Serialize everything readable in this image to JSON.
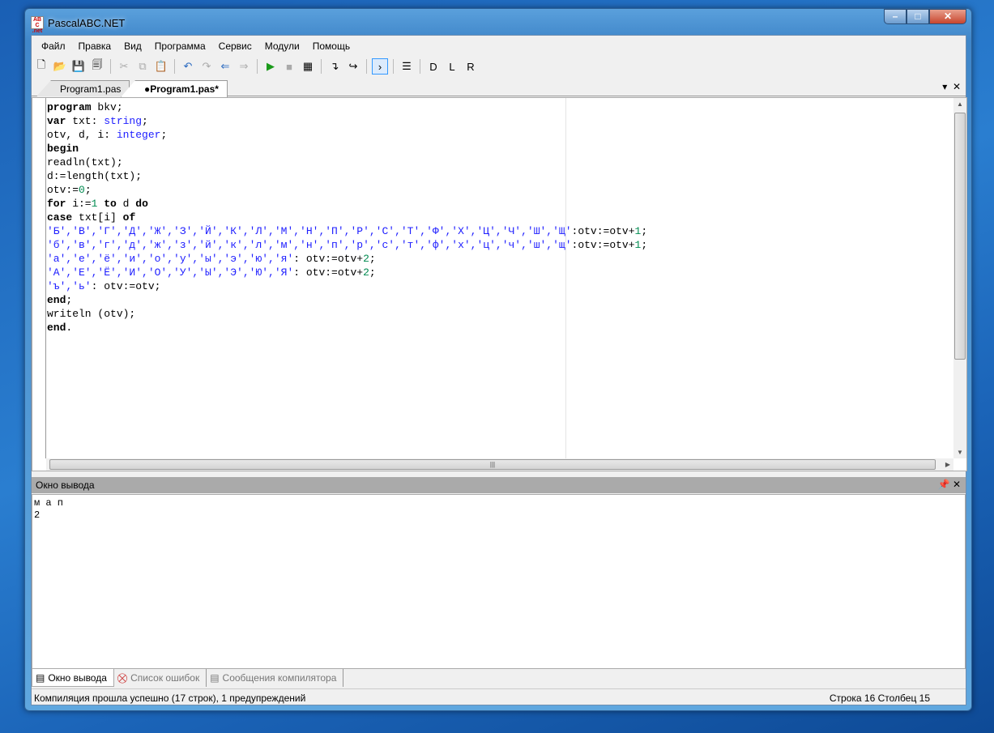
{
  "window": {
    "title": "PascalABC.NET",
    "minimize": "–",
    "maximize": "□",
    "close": "✕"
  },
  "menu": [
    "Файл",
    "Правка",
    "Вид",
    "Программа",
    "Сервис",
    "Модули",
    "Помощь"
  ],
  "toolbar": [
    {
      "name": "new-file",
      "glyph": "🗋"
    },
    {
      "name": "open-file",
      "glyph": "📂"
    },
    {
      "name": "save",
      "glyph": "💾"
    },
    {
      "name": "save-all",
      "glyph": "🗐"
    },
    "sep",
    {
      "name": "cut",
      "glyph": "✂"
    },
    {
      "name": "copy",
      "glyph": "⧉"
    },
    {
      "name": "paste",
      "glyph": "📋"
    },
    "sep",
    {
      "name": "undo",
      "glyph": "↶"
    },
    {
      "name": "redo",
      "glyph": "↷"
    },
    {
      "name": "navigate-back",
      "glyph": "⇐"
    },
    {
      "name": "navigate-forward",
      "glyph": "⇒"
    },
    "sep",
    {
      "name": "run",
      "glyph": "▶"
    },
    {
      "name": "stop",
      "glyph": "■"
    },
    {
      "name": "compile",
      "glyph": "▦"
    },
    "sep",
    {
      "name": "step-into",
      "glyph": "↴"
    },
    {
      "name": "step-over",
      "glyph": "↪"
    },
    "sep",
    {
      "name": "output-window",
      "glyph": "›"
    },
    "sep",
    {
      "name": "format",
      "glyph": "☰"
    },
    "sep",
    {
      "name": "debug-d",
      "glyph": "D"
    },
    {
      "name": "debug-l",
      "glyph": "L"
    },
    {
      "name": "debug-r",
      "glyph": "R"
    }
  ],
  "tabs": [
    {
      "label": "Program1.pas",
      "active": false
    },
    {
      "label": "●Program1.pas*",
      "active": true
    }
  ],
  "code": [
    [
      [
        "program",
        "kw"
      ],
      [
        " bkv;",
        "pl"
      ]
    ],
    [
      [
        "var",
        "kw"
      ],
      [
        " txt: ",
        "pl"
      ],
      [
        "string",
        "ty"
      ],
      [
        ";",
        "pl"
      ]
    ],
    [
      [
        "otv, d, i: ",
        "pl"
      ],
      [
        "integer",
        "ty"
      ],
      [
        ";",
        "pl"
      ]
    ],
    [
      [
        "begin",
        "kw"
      ]
    ],
    [
      [
        "readln(txt);",
        "pl"
      ]
    ],
    [
      [
        "d:=length(txt);",
        "pl"
      ]
    ],
    [
      [
        "otv:=",
        "pl"
      ],
      [
        "0",
        "nm"
      ],
      [
        ";",
        "pl"
      ]
    ],
    [
      [
        "for",
        "kw"
      ],
      [
        " i:=",
        "pl"
      ],
      [
        "1",
        "nm"
      ],
      [
        " ",
        "pl"
      ],
      [
        "to",
        "kw"
      ],
      [
        " d ",
        "pl"
      ],
      [
        "do",
        "kw"
      ]
    ],
    [
      [
        "case",
        "kw"
      ],
      [
        " txt[i] ",
        "pl"
      ],
      [
        "of",
        "kw"
      ]
    ],
    [
      [
        "'Б','В','Г','Д','Ж','З','Й','К','Л','М','Н','П','Р','С','Т','Ф','Х','Ц','Ч','Ш','Щ'",
        "st"
      ],
      [
        ":otv:=otv+",
        "pl"
      ],
      [
        "1",
        "nm"
      ],
      [
        ";",
        "pl"
      ]
    ],
    [
      [
        "'б','в','г','д','ж','з','й','к','л','м','н','п','р','с','т','ф','х','ц','ч','ш','щ'",
        "st"
      ],
      [
        ":otv:=otv+",
        "pl"
      ],
      [
        "1",
        "nm"
      ],
      [
        ";",
        "pl"
      ]
    ],
    [
      [
        "'а','е','ё','и','о','у','ы','э','ю','я'",
        "st"
      ],
      [
        ": otv:=otv+",
        "pl"
      ],
      [
        "2",
        "nm"
      ],
      [
        ";",
        "pl"
      ]
    ],
    [
      [
        "'А','Е','Ё','И','О','У','Ы','Э','Ю','Я'",
        "st"
      ],
      [
        ": otv:=otv+",
        "pl"
      ],
      [
        "2",
        "nm"
      ],
      [
        ";",
        "pl"
      ]
    ],
    [
      [
        "'ъ','ь'",
        "st"
      ],
      [
        ": otv:=otv;",
        "pl"
      ]
    ],
    [
      [
        "end",
        "kw"
      ],
      [
        ";",
        "pl"
      ]
    ],
    [
      [
        "writeln (otv);",
        "pl"
      ]
    ],
    [
      [
        "end",
        "kw"
      ],
      [
        ".",
        "pl"
      ]
    ]
  ],
  "output_panel": {
    "title": "Окно вывода",
    "text": "м а п\n2"
  },
  "bottom_tabs": [
    "Окно вывода",
    "Список ошибок",
    "Сообщения компилятора"
  ],
  "status": {
    "message": "Компиляция прошла успешно (17 строк), 1 предупреждений",
    "position": "Строка  16  Столбец  15"
  }
}
